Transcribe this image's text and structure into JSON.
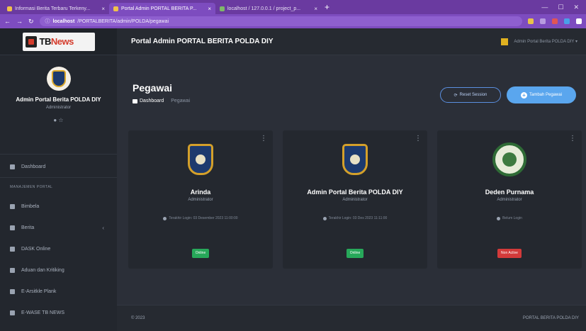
{
  "browser": {
    "tabs": [
      {
        "label": "Informasi Berita Terbaru Terkeny...",
        "active": false
      },
      {
        "label": "Portal Admin PORTAL BERITA P...",
        "active": true
      },
      {
        "label": "localhost / 127.0.0.1 / project_p...",
        "active": false
      }
    ],
    "url_host": "localhost",
    "url_path": "/PORTALBERITA/admin/POLDA/pegawai"
  },
  "brand": {
    "name_a": "TB",
    "name_b": "News"
  },
  "user": {
    "name": "Admin Portal Berita POLDA DIY",
    "role": "Administrator",
    "status": "● ☆"
  },
  "nav": {
    "dashboard": "Dashboard",
    "heading": "MANAJEMEN PORTAL",
    "items": [
      "Bimbela",
      "Berita",
      "DASK Online",
      "Aduan dan Kritiking",
      "E-Arsitkle Plank",
      "E-WASE TB NEWS"
    ]
  },
  "topbar": {
    "title": "Portal Admin PORTAL BERITA POLDA DIY",
    "right_text": "Admin Portal Berita POLDA DIY ▾"
  },
  "page": {
    "title": "Pegawai",
    "crumb_home": "Dashboard",
    "crumb_current": "Pegawai",
    "reset_label": "Reset Session",
    "add_label": "Tambah Pegawai"
  },
  "employees": [
    {
      "name": "Arinda",
      "role": "Administrator",
      "last_login": "Terakhir Login: 03 Desember 2023 11:00:00",
      "status": "Online",
      "online": true,
      "photo": "police-badge"
    },
    {
      "name": "Admin Portal Berita POLDA DIY",
      "role": "Administrator",
      "last_login": "Terakhir Login: 03 Des 2023 11:11:00",
      "status": "Online",
      "online": true,
      "photo": "police-badge"
    },
    {
      "name": "Deden Purnama",
      "role": "Administrator",
      "last_login": "Belum Login",
      "status": "Non Active",
      "online": false,
      "photo": "seal"
    }
  ],
  "footer": {
    "left": "© 2023",
    "right": "PORTAL BERITA POLDA DIY"
  },
  "colors": {
    "accent": "#5aa6ee",
    "online": "#27a85a",
    "offline": "#d33a3a",
    "browser": "#7d4cbf"
  }
}
